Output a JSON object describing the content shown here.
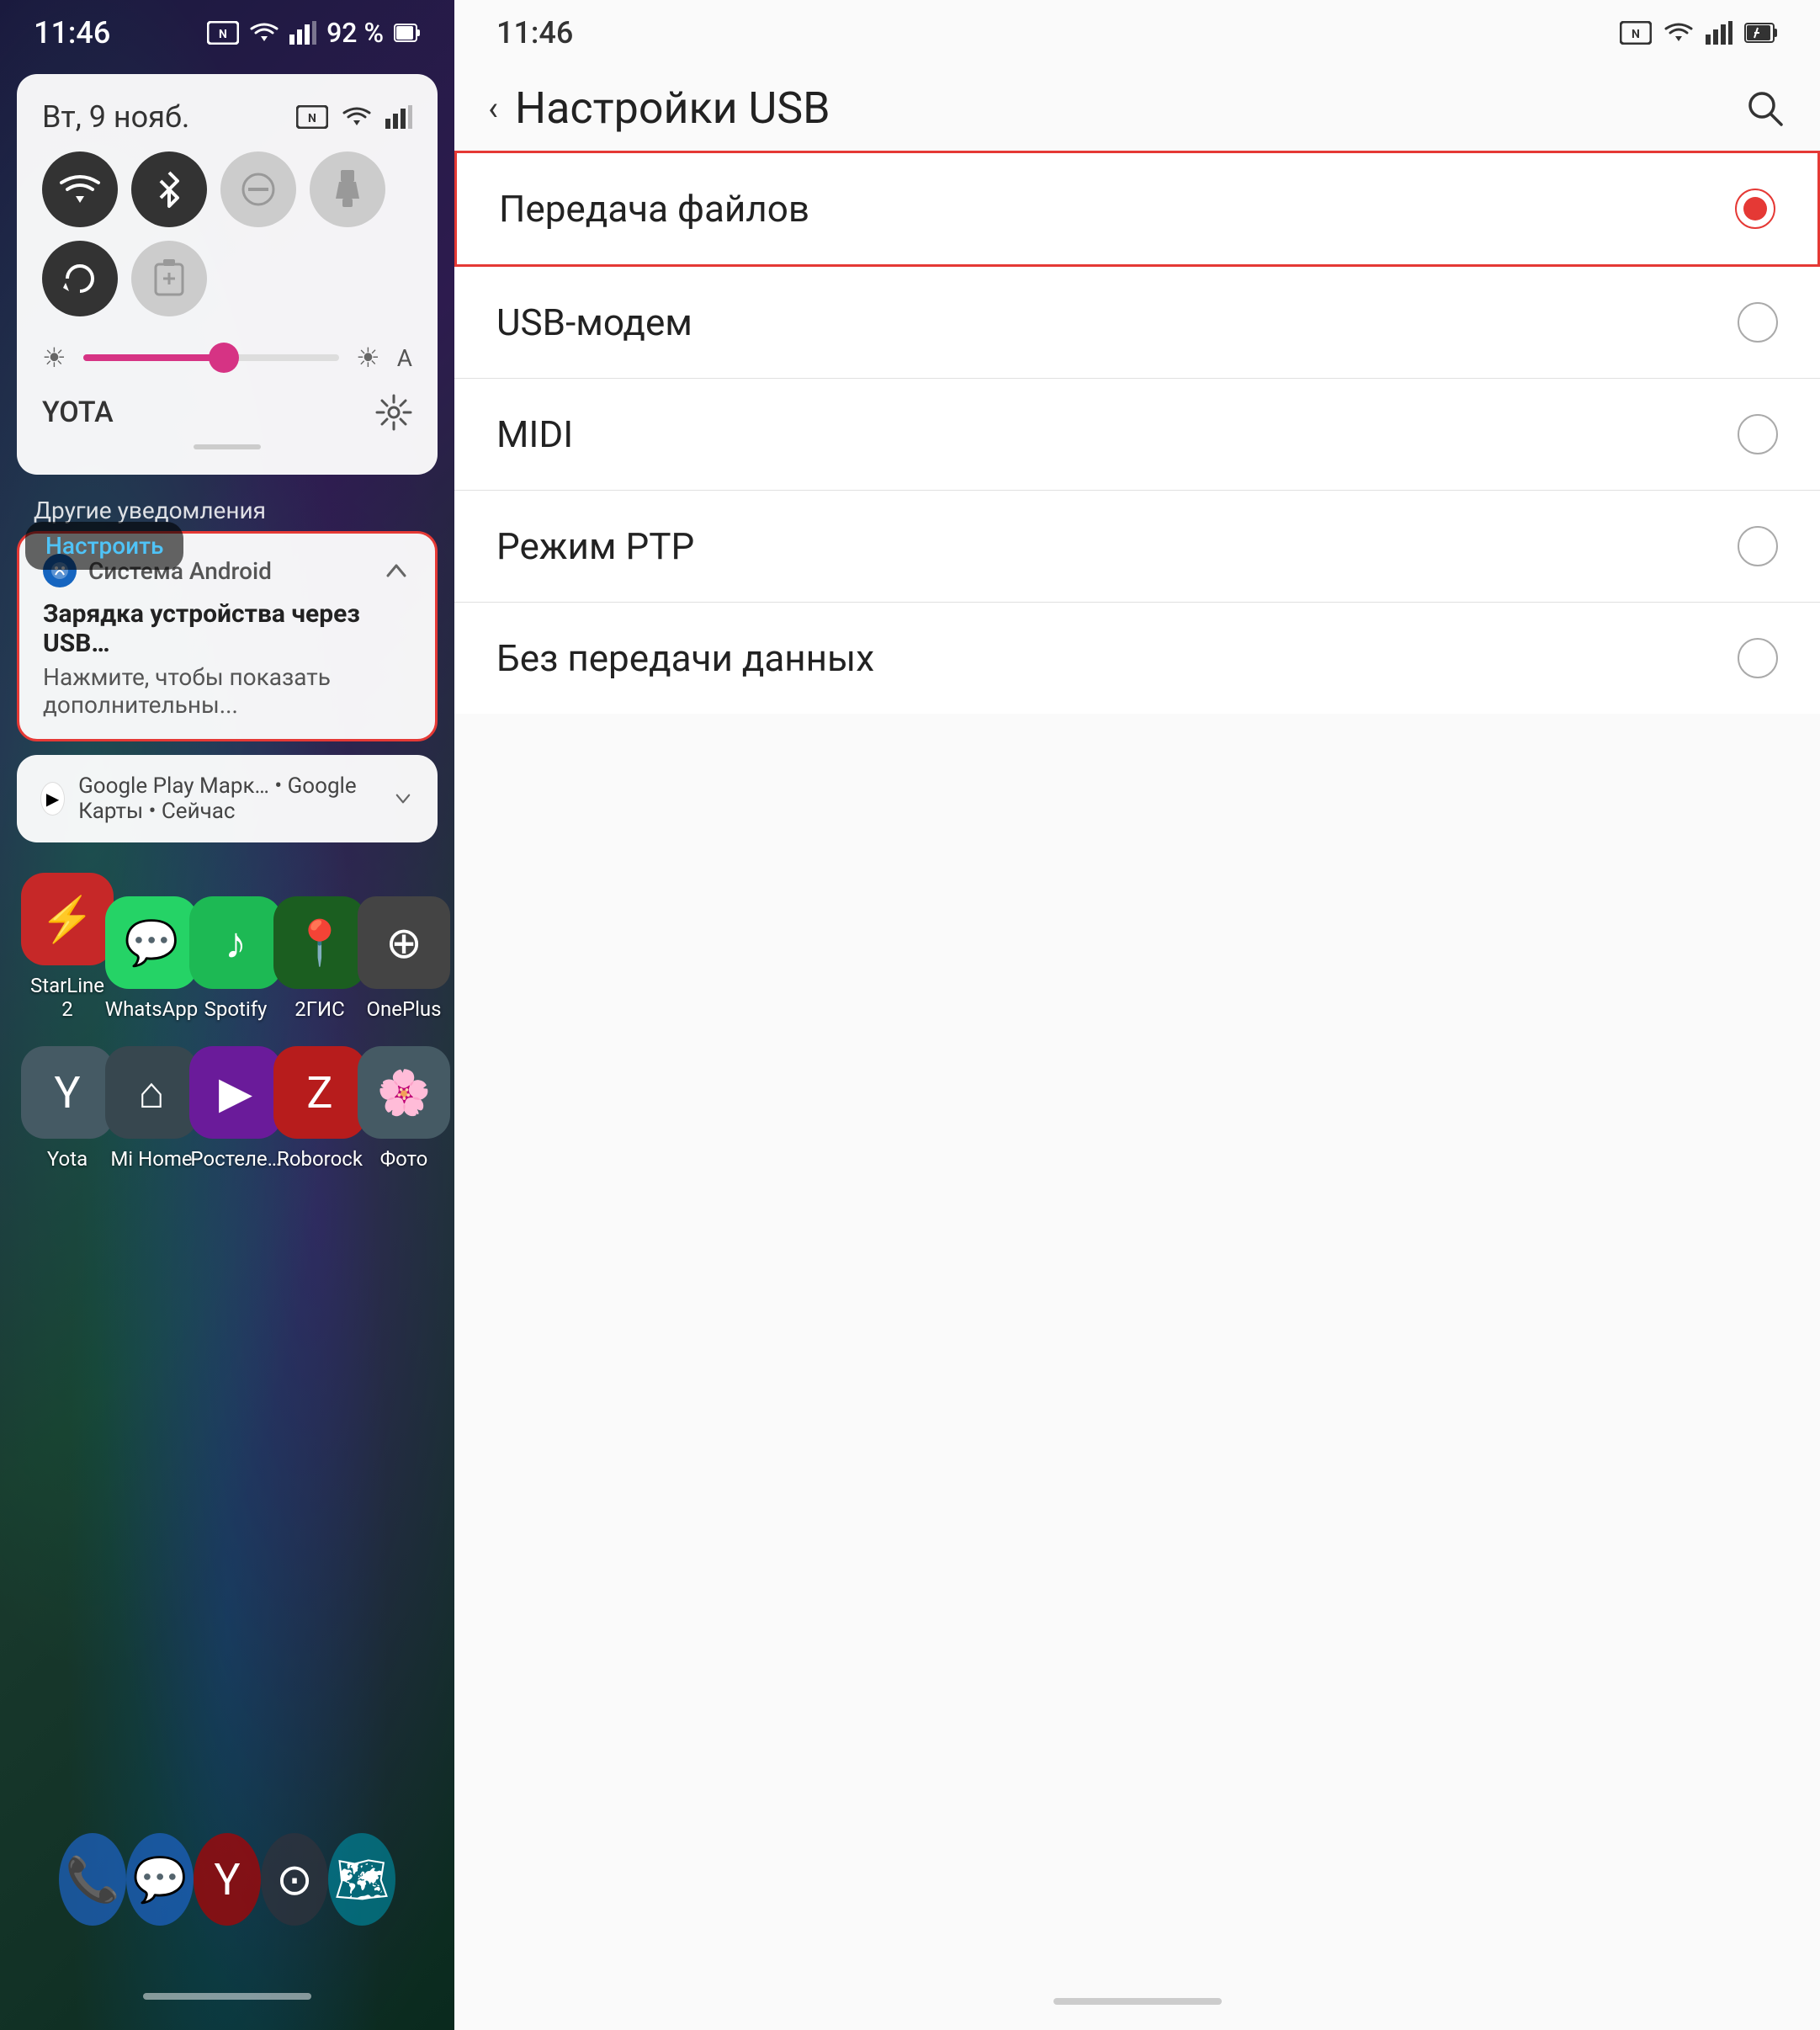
{
  "left": {
    "statusBar": {
      "time": "11:46",
      "battery": "92 %"
    },
    "notificationCard": {
      "date": "Вт, 9 нояб.",
      "wifiLabel": "YOTA"
    },
    "toggles": [
      {
        "id": "wifi",
        "icon": "📶",
        "active": true
      },
      {
        "id": "bluetooth",
        "icon": "⊕",
        "active": true
      },
      {
        "id": "dnd",
        "icon": "⊖",
        "active": false
      },
      {
        "id": "flashlight",
        "icon": "🔦",
        "active": false
      },
      {
        "id": "rotate",
        "icon": "↻",
        "active": true
      },
      {
        "id": "battery-saver",
        "icon": "⊕",
        "active": false
      }
    ],
    "otherNotificationsLabel": "Другие уведомления",
    "androidNotification": {
      "appName": "Система Android",
      "title": "Зарядка устройства через USB…",
      "body": "Нажмите, чтобы показать дополнительны..."
    },
    "googleNotification": {
      "text": "Google Play Марк… • Google Карты • Сейчас"
    },
    "nastroitLabel": "Настроить",
    "appRows": [
      [
        {
          "label": "StarLine 2",
          "color": "#e53935",
          "icon": "⚡"
        },
        {
          "label": "WhatsApp",
          "color": "#25d366",
          "icon": "💬"
        },
        {
          "label": "Spotify",
          "color": "#1db954",
          "icon": "♪"
        },
        {
          "label": "2ГИС",
          "color": "#2e7d32",
          "icon": "📍"
        },
        {
          "label": "OnePlus",
          "color": "#555",
          "icon": "⊕"
        }
      ],
      [
        {
          "label": "Yota",
          "color": "#555",
          "icon": "Y"
        },
        {
          "label": "Mi Home",
          "color": "#555",
          "icon": "⌂"
        },
        {
          "label": "Ростеле…",
          "color": "#7b1fa2",
          "icon": "▶"
        },
        {
          "label": "Roborock",
          "color": "#b71c1c",
          "icon": "Z"
        },
        {
          "label": "Фото",
          "color": "#555",
          "icon": "🌸"
        }
      ]
    ],
    "dockApps": [
      {
        "label": "Телефон",
        "color": "#1976d2",
        "icon": "📞"
      },
      {
        "label": "Сообщения",
        "color": "#1976d2",
        "icon": "💬"
      },
      {
        "label": "Яндекс",
        "color": "#cc0000",
        "icon": "Y"
      },
      {
        "label": "Камера",
        "color": "#555",
        "icon": "⊙"
      },
      {
        "label": "Карты",
        "color": "#0097a7",
        "icon": "🗺"
      }
    ]
  },
  "right": {
    "statusBar": {
      "time": "11:46"
    },
    "header": {
      "title": "Настройки USB",
      "backLabel": "<",
      "searchLabel": "🔍"
    },
    "options": [
      {
        "label": "Передача файлов",
        "selected": true
      },
      {
        "label": "USB-модем",
        "selected": false
      },
      {
        "label": "MIDI",
        "selected": false
      },
      {
        "label": "Режим PTP",
        "selected": false
      },
      {
        "label": "Без передачи данных",
        "selected": false
      }
    ]
  }
}
